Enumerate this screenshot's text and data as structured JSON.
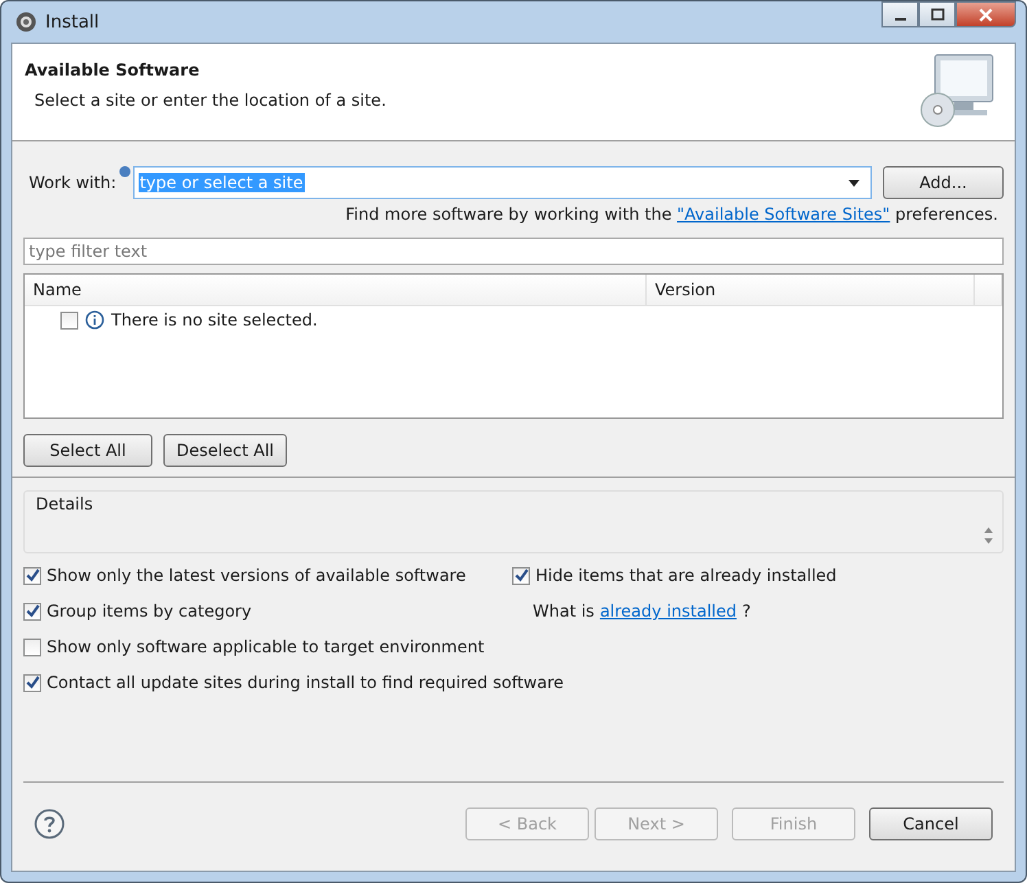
{
  "window": {
    "title": "Install"
  },
  "header": {
    "title": "Available Software",
    "description": "Select a site or enter the location of a site."
  },
  "work_with": {
    "label": "Work with:",
    "value": "type or select a site",
    "add_button": "Add..."
  },
  "more_software": {
    "before": "Find more software by working with the",
    "link": "\"Available Software Sites\"",
    "after": "preferences."
  },
  "filter": {
    "placeholder": "type filter text"
  },
  "table": {
    "columns": [
      "Name",
      "Version"
    ],
    "rows": [
      {
        "text": "There is no site selected.",
        "checked": false
      }
    ]
  },
  "selection_buttons": [
    "Select All",
    "Deselect All"
  ],
  "details": {
    "label": "Details"
  },
  "options": [
    {
      "label": "Show only the latest versions of available software",
      "checked": true
    },
    {
      "label": "Hide items that are already installed",
      "checked": true
    },
    {
      "label": "Group items by category",
      "checked": true
    },
    {
      "label": "Show only software applicable to target environment",
      "checked": false
    },
    {
      "label": "Contact all update sites during install to find required software",
      "checked": true
    }
  ],
  "installed_note": {
    "before": "What is",
    "link": "already installed",
    "after": "?"
  },
  "buttons": [
    {
      "label": "< Back",
      "disabled": true
    },
    {
      "label": "Next >",
      "disabled": true
    },
    {
      "label": "Finish",
      "disabled": true
    },
    {
      "label": "Cancel",
      "disabled": false
    }
  ]
}
